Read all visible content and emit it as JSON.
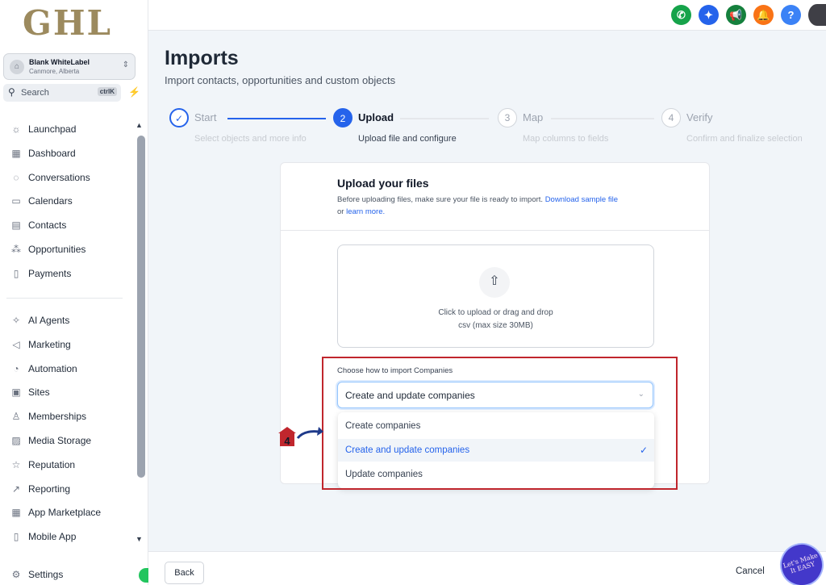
{
  "sidebar": {
    "logo": "GHL",
    "account": {
      "name": "Blank WhiteLabel",
      "location": "Canmore, Alberta"
    },
    "search": {
      "label": "Search",
      "shortcut": "ctrlK"
    },
    "nav_primary": [
      {
        "label": "Launchpad",
        "icon": "rocket-icon"
      },
      {
        "label": "Dashboard",
        "icon": "dashboard-icon"
      },
      {
        "label": "Conversations",
        "icon": "chat-icon"
      },
      {
        "label": "Calendars",
        "icon": "calendar-icon"
      },
      {
        "label": "Contacts",
        "icon": "contacts-icon"
      },
      {
        "label": "Opportunities",
        "icon": "opportunities-icon"
      },
      {
        "label": "Payments",
        "icon": "payments-icon"
      }
    ],
    "nav_secondary": [
      {
        "label": "AI Agents",
        "icon": "sparkle-icon"
      },
      {
        "label": "Marketing",
        "icon": "send-icon"
      },
      {
        "label": "Automation",
        "icon": "automation-icon"
      },
      {
        "label": "Sites",
        "icon": "sites-icon"
      },
      {
        "label": "Memberships",
        "icon": "membership-icon"
      },
      {
        "label": "Media Storage",
        "icon": "media-icon"
      },
      {
        "label": "Reputation",
        "icon": "star-icon"
      },
      {
        "label": "Reporting",
        "icon": "chart-line-icon"
      },
      {
        "label": "App Marketplace",
        "icon": "grid-icon"
      },
      {
        "label": "Mobile App",
        "icon": "mobile-icon"
      }
    ],
    "settings_label": "Settings"
  },
  "topbar": {
    "icons": [
      {
        "name": "phone-icon",
        "glyph": "✆",
        "color": "#16a34a"
      },
      {
        "name": "magic-icon",
        "glyph": "✦",
        "color": "#2563eb"
      },
      {
        "name": "megaphone-icon",
        "glyph": "📢",
        "color": "#15803d"
      },
      {
        "name": "bell-icon",
        "glyph": "🔔",
        "color": "#f97316"
      },
      {
        "name": "help-icon",
        "glyph": "?",
        "color": "#3b82f6"
      }
    ]
  },
  "page": {
    "title": "Imports",
    "subtitle": "Import contacts, opportunities and custom objects"
  },
  "steps": [
    {
      "number": "✓",
      "label": "Start",
      "description": "Select objects and more info",
      "state": "done"
    },
    {
      "number": "2",
      "label": "Upload",
      "description": "Upload file and configure",
      "state": "active"
    },
    {
      "number": "3",
      "label": "Map",
      "description": "Map columns to fields",
      "state": "todo"
    },
    {
      "number": "4",
      "label": "Verify",
      "description": "Confirm and finalize selection",
      "state": "todo"
    }
  ],
  "upload": {
    "title": "Upload your files",
    "desc_text": "Before uploading files, make sure your file is ready to import.",
    "sample_link": "Download sample file",
    "or_text": "or",
    "learn_link": "learn more.",
    "drop_text": "Click to upload or drag and drop",
    "drop_hint": "csv (max size 30MB)"
  },
  "import_mode": {
    "label": "Choose how to import Companies",
    "selected": "Create and update companies",
    "options": [
      "Create companies",
      "Create and update companies",
      "Update companies"
    ],
    "selected_index": 1
  },
  "annotation": {
    "step_number": "4"
  },
  "footer": {
    "back_label": "Back",
    "cancel_label": "Cancel",
    "badge_text": "Let's Make It EASY"
  },
  "colors": {
    "accent": "#2563eb",
    "highlight_box": "#c0262d"
  }
}
